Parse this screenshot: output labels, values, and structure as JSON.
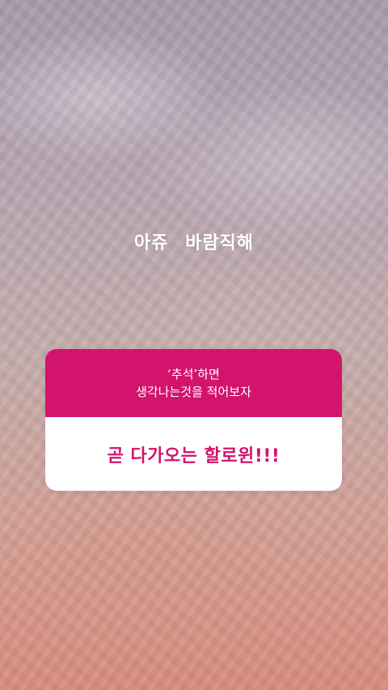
{
  "story": {
    "caption": "아쥬  바람직해",
    "question_box": {
      "question_line1": "‘추석’하면",
      "question_line2": "생각나는것을 적어보자",
      "answer": "곧 다가오는 할로윈!!!",
      "accent_color": "#d3146c"
    }
  }
}
